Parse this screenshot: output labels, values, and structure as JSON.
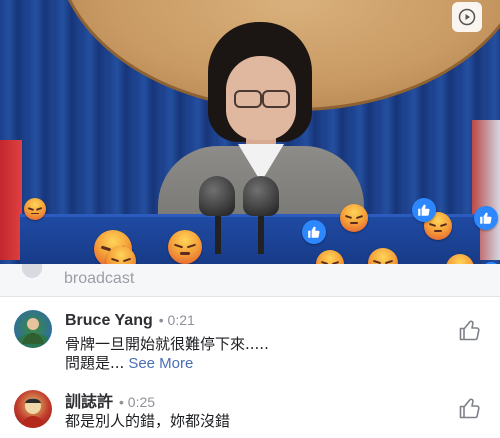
{
  "broadcast_label": "broadcast",
  "comments": [
    {
      "name": "Bruce Yang",
      "time": "• 0:21",
      "text_line1": "骨牌一旦開始就很難停下來.....",
      "text_line2": "問題是...",
      "see_more": "See More"
    },
    {
      "name": "訓誌許",
      "time": "• 0:25",
      "text_line1": "都是別人的錯，妳都沒錯"
    }
  ],
  "icons": {
    "reaction_angry": "angry-reaction-icon",
    "reaction_like": "like-reaction-icon",
    "comment_like": "thumbs-up-icon",
    "play": "play-badge-icon"
  },
  "colors": {
    "like_blue": "#2d88ff",
    "link_blue": "#4a6fb5",
    "text_dark": "#1c1e21",
    "muted_gray": "#8e9199"
  }
}
